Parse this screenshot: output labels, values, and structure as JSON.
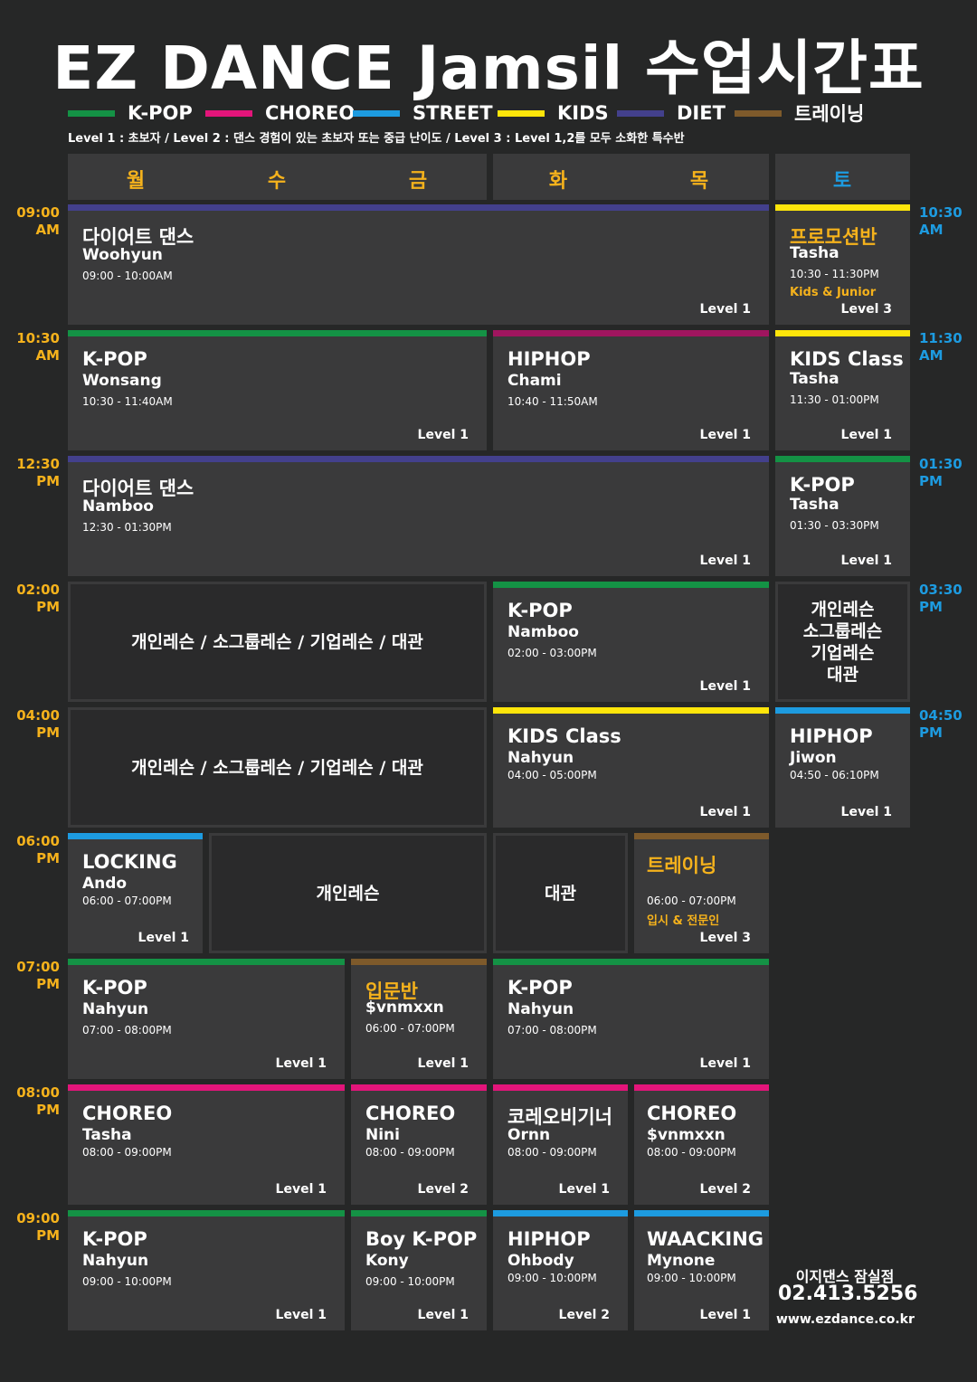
{
  "title": "EZ DANCE Jamsil 수업시간표",
  "colors": {
    "kpop": "#149245",
    "choreo": "#e3157a",
    "street": "#1d9be0",
    "kids": "#fde50a",
    "diet": "#43408c",
    "training": "#7e5a2b",
    "hiphop_bar": "#a0155f",
    "accent_orange": "#f5b21c",
    "accent_blue": "#1d9be0"
  },
  "legend": [
    {
      "label": "K-POP",
      "color": "#149245"
    },
    {
      "label": "CHOREO",
      "color": "#e3157a"
    },
    {
      "label": "STREET",
      "color": "#1d9be0"
    },
    {
      "label": "KIDS",
      "color": "#fde50a"
    },
    {
      "label": "DIET",
      "color": "#43408c"
    },
    {
      "label": "트레이닝",
      "color": "#7e5a2b"
    }
  ],
  "level_desc": "Level 1 : 초보자  / Level 2 : 댄스 경험이 있는 초보자 또는 중급 난이도 / Level 3 : Level 1,2를 모두 소화한 특수반",
  "days": [
    "월",
    "수",
    "금",
    "화",
    "목",
    "토"
  ],
  "times_left": [
    [
      "09:00",
      "AM"
    ],
    [
      "10:30",
      "AM"
    ],
    [
      "12:30",
      "PM"
    ],
    [
      "02:00",
      "PM"
    ],
    [
      "04:00",
      "PM"
    ],
    [
      "06:00",
      "PM"
    ],
    [
      "07:00",
      "PM"
    ],
    [
      "08:00",
      "PM"
    ],
    [
      "09:00",
      "PM"
    ]
  ],
  "times_right": [
    [
      "10:30",
      "AM"
    ],
    [
      "11:30",
      "AM"
    ],
    [
      "01:30",
      "PM"
    ],
    [
      "03:30",
      "PM"
    ],
    [
      "04:50",
      "PM"
    ]
  ],
  "classes": {
    "r1_mwf": {
      "name": "다이어트 댄스",
      "teacher": "Woohyun",
      "time": "09:00 - 10:00AM",
      "level": "Level 1"
    },
    "r1_sat": {
      "name": "프로모션반",
      "teacher": "Tasha",
      "time": "10:30 - 11:30PM",
      "note": "Kids & Junior",
      "level": "Level 3"
    },
    "r2_mwf": {
      "name": "K-POP",
      "teacher": "Wonsang",
      "time": "10:30 - 11:40AM",
      "level": "Level 1"
    },
    "r2_tt": {
      "name": "HIPHOP",
      "teacher": "Chami",
      "time": "10:40 - 11:50AM",
      "level": "Level 1"
    },
    "r2_sat": {
      "name": "KIDS Class",
      "teacher": "Tasha",
      "time": "11:30 - 01:00PM",
      "level": "Level 1"
    },
    "r3_all": {
      "name": "다이어트 댄스",
      "teacher": "Namboo",
      "time": "12:30 - 01:30PM",
      "level": "Level 1"
    },
    "r3_sat": {
      "name": "K-POP",
      "teacher": "Tasha",
      "time": "01:30 - 03:30PM",
      "level": "Level 1"
    },
    "r4_tt": {
      "name": "K-POP",
      "teacher": "Namboo",
      "time": "02:00 - 03:00PM",
      "level": "Level 1"
    },
    "r5_tt": {
      "name": "KIDS Class",
      "teacher": "Nahyun",
      "time": "04:00 - 05:00PM",
      "level": "Level 1"
    },
    "r5_sat": {
      "name": "HIPHOP",
      "teacher": "Jiwon",
      "time": "04:50 - 06:10PM",
      "level": "Level 1"
    },
    "r6_mon": {
      "name": "LOCKING",
      "teacher": "Ando",
      "time": "06:00 - 07:00PM",
      "level": "Level 1"
    },
    "r6_thu": {
      "name": "트레이닝",
      "time": "06:00 - 07:00PM",
      "note": "입시 & 전문인",
      "level": "Level 3"
    },
    "r7_mw": {
      "name": "K-POP",
      "teacher": "Nahyun",
      "time": "07:00 - 08:00PM",
      "level": "Level 1"
    },
    "r7_fri": {
      "name": "입문반",
      "teacher": "$vnmxxn",
      "time": "06:00 - 07:00PM",
      "level": "Level 1"
    },
    "r7_tt": {
      "name": "K-POP",
      "teacher": "Nahyun",
      "time": "07:00 - 08:00PM",
      "level": "Level 1"
    },
    "r8_mw": {
      "name": "CHOREO",
      "teacher": "Tasha",
      "time": "08:00 - 09:00PM",
      "level": "Level 1"
    },
    "r8_fri": {
      "name": "CHOREO",
      "teacher": "Nini",
      "time": "08:00 - 09:00PM",
      "level": "Level 2"
    },
    "r8_tue": {
      "name": "코레오비기너",
      "teacher": "Ornn",
      "time": "08:00 - 09:00PM",
      "level": "Level 1"
    },
    "r8_thu": {
      "name": "CHOREO",
      "teacher": "$vnmxxn",
      "time": "08:00 - 09:00PM",
      "level": "Level 2"
    },
    "r9_mw": {
      "name": "K-POP",
      "teacher": "Nahyun",
      "time": "09:00 - 10:00PM",
      "level": "Level 1"
    },
    "r9_fri": {
      "name": "Boy K-POP",
      "teacher": "Kony",
      "time": "09:00 - 10:00PM",
      "level": "Level 1"
    },
    "r9_tue": {
      "name": "HIPHOP",
      "teacher": "Ohbody",
      "time": "09:00 - 10:00PM",
      "level": "Level 2"
    },
    "r9_thu": {
      "name": "WAACKING",
      "teacher": "Mynone",
      "time": "09:00 - 10:00PM",
      "level": "Level 1"
    }
  },
  "blocks": {
    "r4_mwf": "개인레슨 / 소그룹레슨 / 기업레슨 / 대관",
    "r4_sat": [
      "개인레슨",
      "소그룹레슨",
      "기업레슨",
      "대관"
    ],
    "r5_mwf": "개인레슨 / 소그룹레슨 / 기업레슨 / 대관",
    "r6_wf": "개인레슨",
    "r6_tue": "대관"
  },
  "footer": {
    "name": "이지댄스 잠실점",
    "phone": "02.413.5256",
    "website": "www.ezdance.co.kr"
  }
}
